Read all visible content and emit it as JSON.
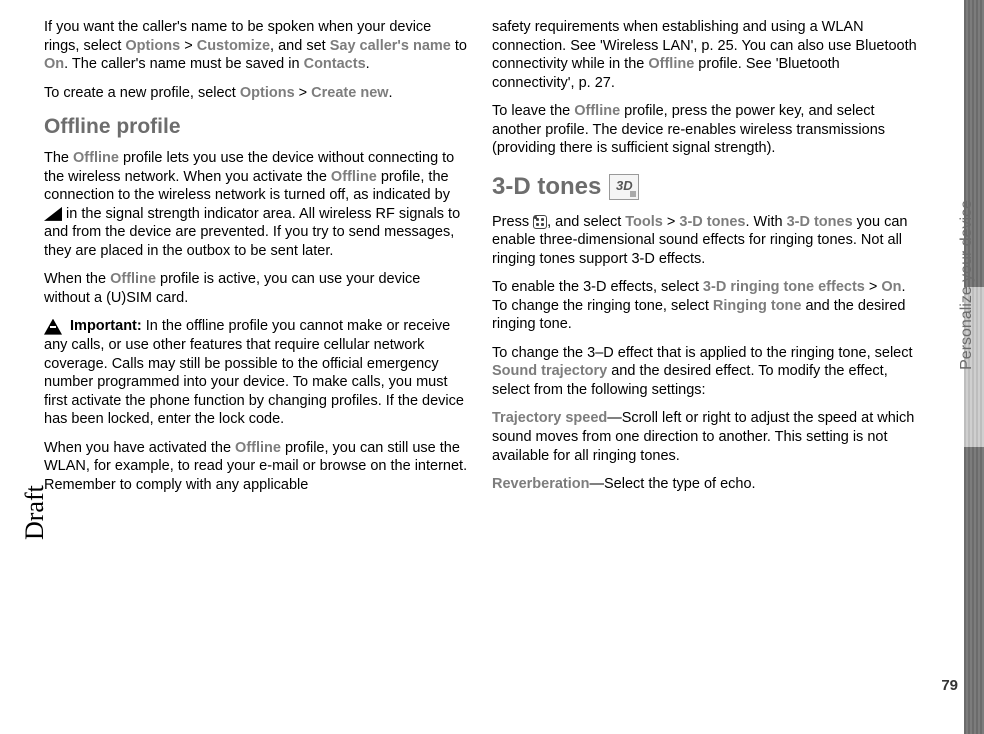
{
  "sideLabel": "Personalize your device",
  "pageNumber": "79",
  "watermark": "Draft",
  "left": {
    "p1_a": "If you want the caller's name to be spoken when your device rings, select ",
    "p1_opt": "Options",
    "p1_gt1": " > ",
    "p1_cust": "Customize",
    "p1_b": ", and set ",
    "p1_say": "Say caller's name",
    "p1_c": " to ",
    "p1_on": "On",
    "p1_d": ". The caller's name must be saved in ",
    "p1_contacts": "Contacts",
    "p1_e": ".",
    "p2_a": "To create a new profile, select ",
    "p2_opt": "Options",
    "p2_gt": " > ",
    "p2_new": "Create new",
    "p2_b": ".",
    "h2": "Offline profile",
    "p3_a": "The ",
    "p3_off1": "Offline",
    "p3_b": " profile lets you use the device without connecting to the wireless network. When you activate the ",
    "p3_off2": "Offline",
    "p3_c": " profile, the connection to the wireless network is turned off, as indicated by ",
    "p3_d": " in the signal strength indicator area. All wireless RF signals to and from the device are prevented. If you try to send messages, they are placed in the outbox to be sent later.",
    "p4_a": "When the ",
    "p4_off": "Offline",
    "p4_b": " profile is active, you can use your device without a (U)SIM card.",
    "p5_imp": "Important:",
    "p5_a": " In the offline profile you cannot make or receive any calls, or use other features that require cellular network coverage. Calls may still be possible to the official emergency number programmed into your device. To make calls, you must first activate the phone function by changing profiles. If the device has been locked, enter the lock code.",
    "p6_a": "When you have activated the ",
    "p6_off": "Offline",
    "p6_b": " profile, you can still use the WLAN, for example, to read your e-mail or browse on the internet. Remember to comply with any applicable"
  },
  "right": {
    "p1_a": "safety requirements when establishing and using a WLAN connection. See 'Wireless LAN', p. 25. You can also use Bluetooth connectivity while in the ",
    "p1_off": "Offline",
    "p1_b": " profile. See 'Bluetooth connectivity', p. 27.",
    "p2_a": "To leave the ",
    "p2_off": "Offline",
    "p2_b": " profile, press the power key, and select another profile. The device re-enables wireless transmissions (providing there is sufficient signal strength).",
    "h2": "3-D tones",
    "iconLabel": "3D",
    "p3_a": "Press ",
    "p3_b": ", and select ",
    "p3_tools": "Tools",
    "p3_gt": " > ",
    "p3_3d": "3-D tones",
    "p3_c": ". With ",
    "p3_3d2": "3-D tones",
    "p3_d": " you can enable three-dimensional sound effects for ringing tones. Not all ringing tones support 3-D effects.",
    "p4_a": "To enable the 3-D effects, select ",
    "p4_eff": "3-D ringing tone effects",
    "p4_gt": " > ",
    "p4_on": "On",
    "p4_b": ". To change the ringing tone, select ",
    "p4_rt": "Ringing tone",
    "p4_c": " and the desired ringing tone.",
    "p5_a": "To change the 3–D effect that is applied to the ringing tone, select ",
    "p5_st": "Sound trajectory",
    "p5_b": " and the desired effect. To modify the effect, select from the following settings:",
    "p6_ts": "Trajectory speed",
    "p6_a": "—Scroll left or right to adjust the speed at which sound moves from one direction to another. This setting is not available for all ringing tones.",
    "p7_rv": "Reverberation",
    "p7_a": "—Select the type of echo."
  }
}
